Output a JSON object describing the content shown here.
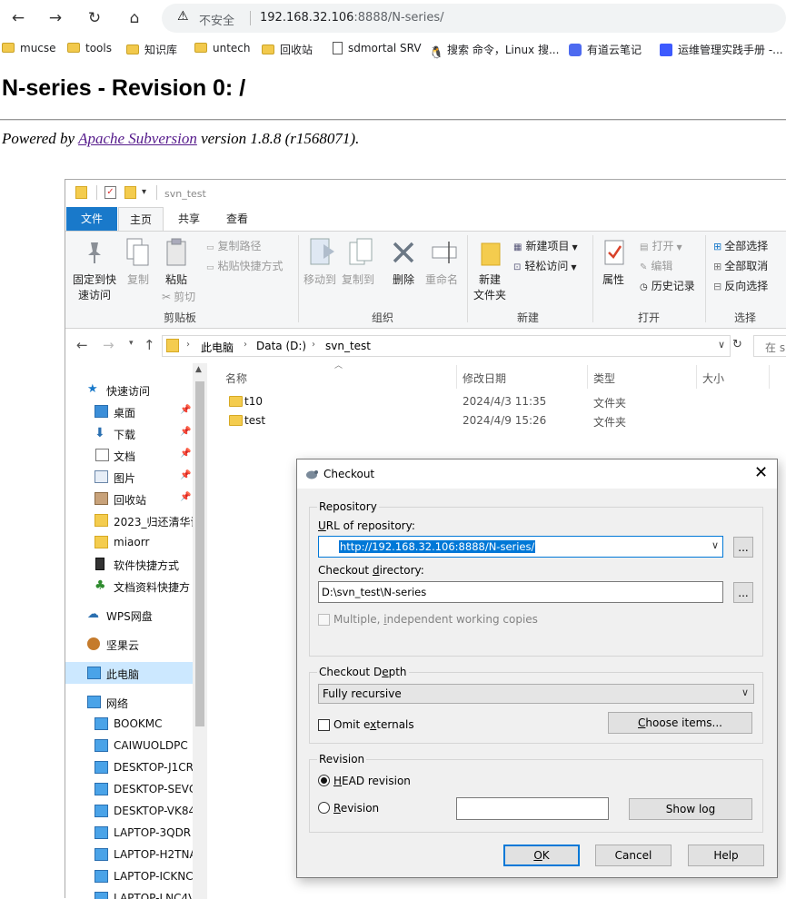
{
  "browser": {
    "security_label": "不安全",
    "url_host": "192.168.32.106",
    "url_rest": ":8888/N-series/",
    "bookmarks": [
      "mucse",
      "tools",
      "知识库",
      "untech",
      "回收站",
      "sdmortal SRV",
      "搜索 命令，Linux 搜...",
      "有道云笔记",
      "运维管理实践手册 -..."
    ]
  },
  "svn_page": {
    "title": "N-series - Revision 0: /",
    "powered_by": "Powered by",
    "link_text": "Apache Subversion",
    "version_text": "version 1.8.8 (r1568071)."
  },
  "explorer": {
    "window_title": "svn_test",
    "tabs": [
      "文件",
      "主页",
      "共享",
      "查看"
    ],
    "ribbon": {
      "pin_line1": "固定到快",
      "pin_line2": "速访问",
      "copy": "复制",
      "paste": "粘贴",
      "copy_path": "复制路径",
      "paste_shortcut": "粘贴快捷方式",
      "cut": "剪切",
      "move_to": "移动到",
      "copy_to": "复制到",
      "delete": "删除",
      "rename": "重命名",
      "new_folder_line1": "新建",
      "new_folder_line2": "文件夹",
      "new_item": "新建项目",
      "easy_access": "轻松访问",
      "properties": "属性",
      "open": "打开",
      "edit": "编辑",
      "history": "历史记录",
      "select_all": "全部选择",
      "select_none": "全部取消",
      "invert_selection": "反向选择",
      "groups": [
        "剪贴板",
        "组织",
        "新建",
        "打开",
        "选择"
      ]
    },
    "breadcrumb": [
      "此电脑",
      "Data (D:)",
      "svn_test"
    ],
    "search_placeholder": "在 s",
    "columns": [
      "名称",
      "修改日期",
      "类型",
      "大小"
    ],
    "files": [
      {
        "name": "t10",
        "date": "2024/4/3 11:35",
        "type": "文件夹"
      },
      {
        "name": "test",
        "date": "2024/4/9 15:26",
        "type": "文件夹"
      }
    ],
    "nav": {
      "quick_access": "快速访问",
      "quick_items": [
        "桌面",
        "下载",
        "文档",
        "图片",
        "回收站"
      ],
      "folders": [
        "2023_归还清华读",
        "miaorr",
        "软件快捷方式",
        "文档资料快捷方"
      ],
      "wps": "WPS网盘",
      "jianguo": "坚果云",
      "this_pc": "此电脑",
      "network": "网络",
      "computers": [
        "BOOKMC",
        "CAIWUOLDPC",
        "DESKTOP-J1CR",
        "DESKTOP-SEVC",
        "DESKTOP-VK84",
        "LAPTOP-3QDR",
        "LAPTOP-H2TNA",
        "LAPTOP-ICKNC",
        "LAPTOP-LNC4V"
      ]
    }
  },
  "checkout": {
    "title": "Checkout",
    "repository_group": "Repository",
    "url_label_pre": "",
    "url_label_u": "U",
    "url_label_post": "RL of repository:",
    "url_value": "http://192.168.32.106:8888/N-series/",
    "dir_label_pre": "Checkout ",
    "dir_label_u": "d",
    "dir_label_post": "irectory:",
    "dir_value": "D:\\svn_test\\N-series",
    "browse": "...",
    "multiple_pre": "Multiple, ",
    "multiple_u": "i",
    "multiple_post": "ndependent working copies",
    "depth_group_pre": "Checkout D",
    "depth_group_u": "e",
    "depth_group_post": "pth",
    "depth_value": "Fully recursive",
    "omit_pre": "Omit e",
    "omit_u": "x",
    "omit_post": "ternals",
    "choose_items_pre": "",
    "choose_items_u": "C",
    "choose_items_post": "hoose items...",
    "revision_group": "Revision",
    "head_pre": "",
    "head_u": "H",
    "head_post": "EAD revision",
    "revision_pre": "",
    "revision_u": "R",
    "revision_post": "evision",
    "revision_value": "",
    "show_log": "Show log",
    "ok_u": "O",
    "ok_post": "K",
    "cancel": "Cancel",
    "help": "Help"
  }
}
